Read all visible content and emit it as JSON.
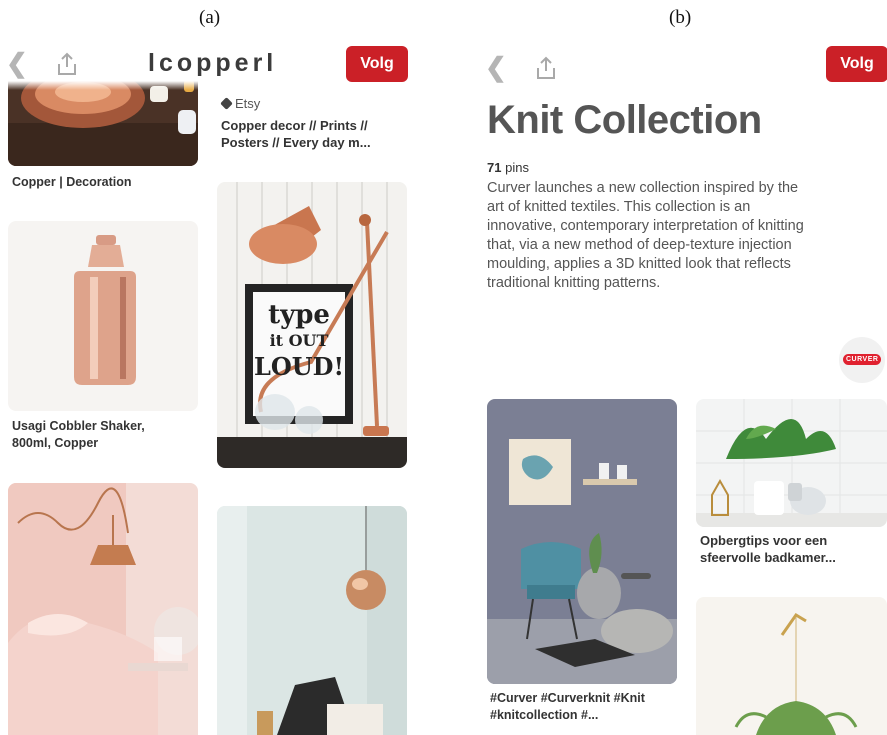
{
  "captions": {
    "a": "(a)",
    "b": "(b)"
  },
  "panel_a": {
    "board_name": "lcopperl",
    "follow_label": "Volg",
    "pins": [
      {
        "title": "Copper | Decoration"
      },
      {
        "source": "Etsy",
        "title": "Copper decor // Prints // Posters // Every day m..."
      },
      {
        "title": "Usagi Cobbler Shaker, 800ml, Copper"
      },
      {
        "poster_lines": [
          "type",
          "it OUT",
          "LOUD!"
        ]
      }
    ]
  },
  "panel_b": {
    "follow_label": "Volg",
    "title": "Knit Collection",
    "pin_count": "71",
    "pin_count_label": "pins",
    "description": "Curver launches a new collection inspired by the art of knitted textiles. This collection is an innovative, contemporary interpretation of knitting that, via a new method of deep-texture injection moulding, applies a 3D knitted look that reflects traditional knitting patterns.",
    "brand_badge": "CURVER",
    "pins": [
      {
        "title": "#Curver #Curverknit #Knit #knitcollection #..."
      },
      {
        "title": "Opbergtips voor een sfeervolle badkamer..."
      }
    ]
  },
  "colors": {
    "follow": "#cb2027",
    "title": "#555555",
    "text": "#333333"
  }
}
